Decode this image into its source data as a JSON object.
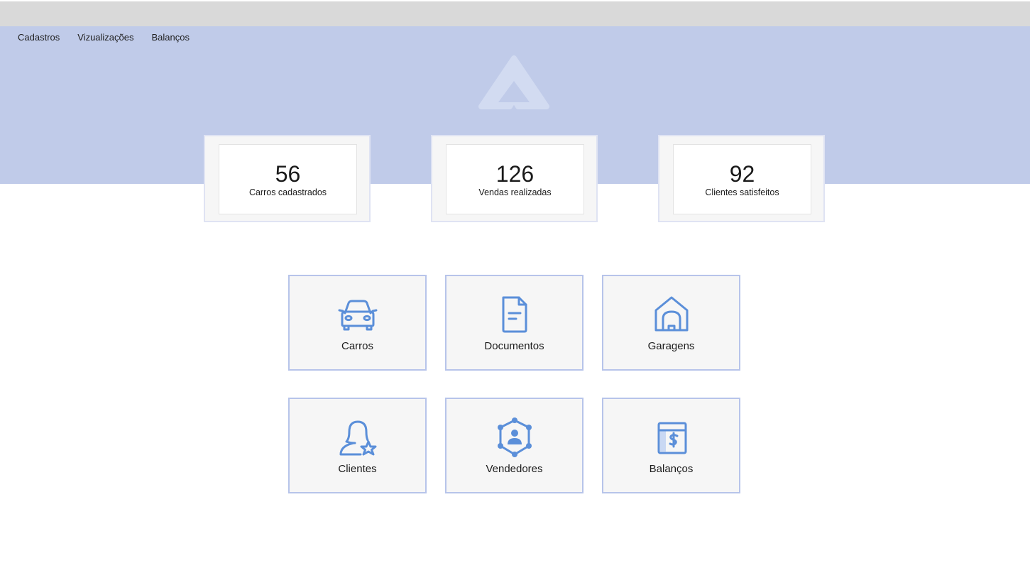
{
  "nav": {
    "items": [
      {
        "label": "Cadastros"
      },
      {
        "label": "Vizualizações"
      },
      {
        "label": "Balanços"
      }
    ]
  },
  "stats": [
    {
      "value": "56",
      "label": "Carros cadastrados"
    },
    {
      "value": "126",
      "label": "Vendas realizadas"
    },
    {
      "value": "92",
      "label": "Clientes satisfeitos"
    }
  ],
  "tiles": [
    {
      "label": "Carros",
      "icon": "car-icon"
    },
    {
      "label": "Documentos",
      "icon": "document-icon"
    },
    {
      "label": "Garagens",
      "icon": "garage-icon"
    },
    {
      "label": "Clientes",
      "icon": "client-star-icon"
    },
    {
      "label": "Vendedores",
      "icon": "seller-network-icon"
    },
    {
      "label": "Balanços",
      "icon": "dollar-book-icon"
    }
  ],
  "colors": {
    "hero": "#c0cbe9",
    "accent": "#5b8fd9",
    "tile_border": "#b7c4ea",
    "top_strip": "#d9d9d9"
  }
}
